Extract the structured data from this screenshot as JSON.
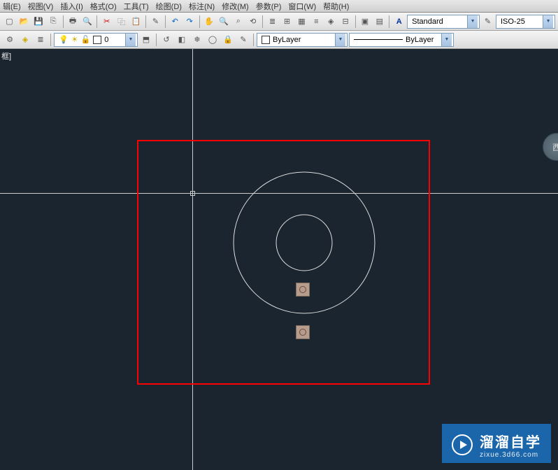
{
  "menu": {
    "items": [
      {
        "label": "辑(E)"
      },
      {
        "label": "视图(V)"
      },
      {
        "label": "插入(I)"
      },
      {
        "label": "格式(O)"
      },
      {
        "label": "工具(T)"
      },
      {
        "label": "绘图(D)"
      },
      {
        "label": "标注(N)"
      },
      {
        "label": "修改(M)"
      },
      {
        "label": "参数(P)"
      },
      {
        "label": "窗口(W)"
      },
      {
        "label": "帮助(H)"
      }
    ]
  },
  "toolbar1": {
    "dropdowns": {
      "text_style": {
        "value": "Standard"
      },
      "dim_style": {
        "value": "ISO-25"
      }
    }
  },
  "toolbar2": {
    "layer": {
      "value": "0"
    },
    "color": {
      "value": "ByLayer"
    },
    "linetype": {
      "value": "ByLayer"
    }
  },
  "canvas": {
    "doc_title": "框]",
    "nav_label": "西"
  },
  "watermark": {
    "title": "溜溜自学",
    "url": "zixue.3d66.com"
  },
  "colors": {
    "canvas_bg": "#1a2530",
    "highlight": "#ff0000",
    "grip": "#b69c8c"
  }
}
